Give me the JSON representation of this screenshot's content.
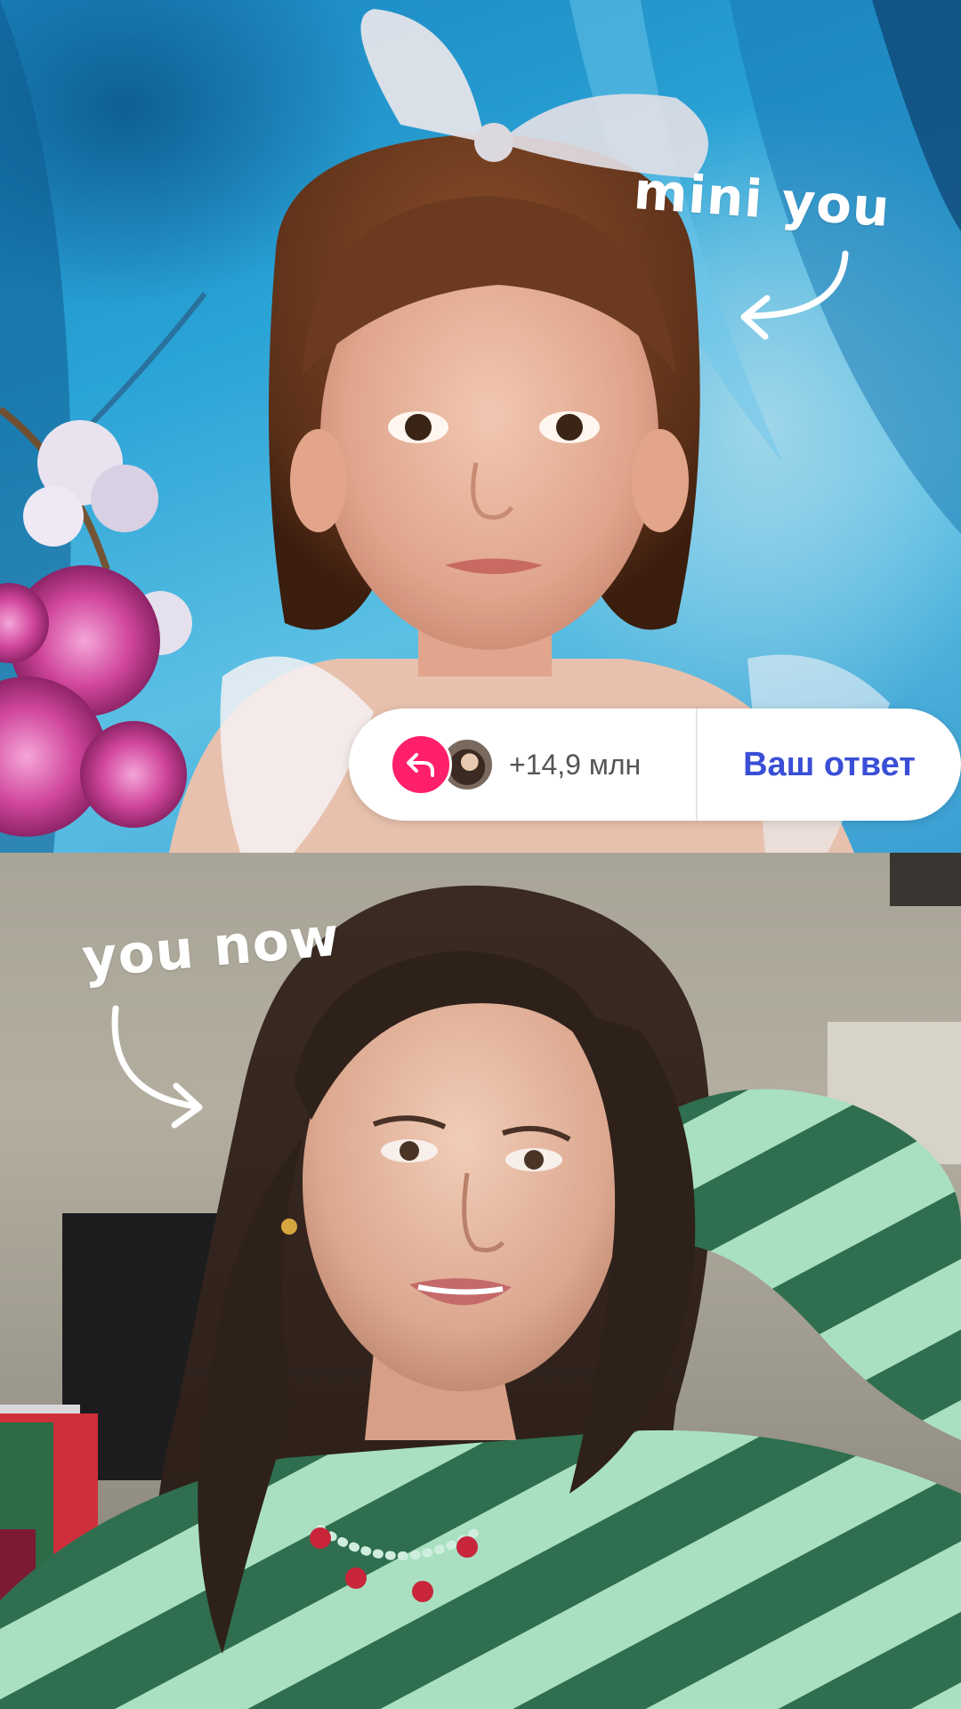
{
  "top_photo": {
    "caption": "mini you"
  },
  "bottom_photo": {
    "caption": "you now"
  },
  "reply_bar": {
    "icon": "reply-arrow-icon",
    "count": "+14,9 млн",
    "answer_label": "Ваш ответ",
    "accent_color": "#ff1f6d",
    "answer_color": "#3a4fd6"
  }
}
